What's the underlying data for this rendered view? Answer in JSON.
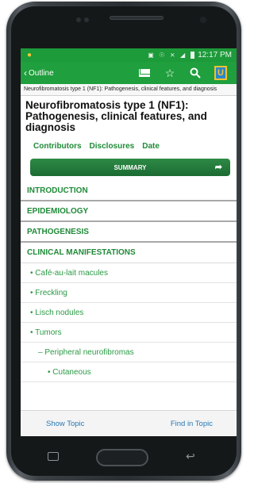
{
  "statusbar": {
    "icons": "▣ ☉ ⨯ ◢",
    "battery_pct": "97%",
    "time": "12:17 PM"
  },
  "appbar": {
    "back_label": "Outline",
    "actions": [
      "mail-icon",
      "star-icon",
      "search-icon",
      "uptodate-logo-icon"
    ]
  },
  "breadcrumb": "Neurofibromatosis type 1 (NF1): Pathogenesis, clinical features, and diagnosis",
  "title": "Neurofibromatosis type 1 (NF1): Pathogenesis, clinical features, and diagnosis",
  "meta_links": {
    "contributors": "Contributors",
    "disclosures": "Disclosures",
    "date": "Date"
  },
  "summary_button": "SUMMARY",
  "outline": {
    "sections": [
      "INTRODUCTION",
      "EPIDEMIOLOGY",
      "PATHOGENESIS",
      "CLINICAL MANIFESTATIONS"
    ],
    "subitems": [
      "• Café-au-lait macules",
      "• Freckling",
      "• Lisch nodules",
      "• Tumors",
      "– Peripheral neurofibromas",
      "• Cutaneous"
    ]
  },
  "bottombar": {
    "show_topic": "Show Topic",
    "find_in_topic": "Find in Topic"
  },
  "colors": {
    "appbar_green": "#1f9f3d",
    "link_green": "#1f8a38",
    "link_blue": "#2779b5"
  }
}
